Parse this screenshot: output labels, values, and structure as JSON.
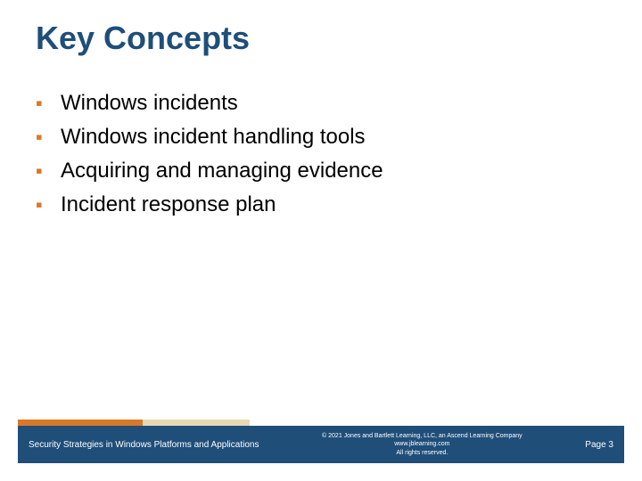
{
  "title": "Key Concepts",
  "bullets": [
    "Windows incidents",
    "Windows incident handling tools",
    "Acquiring and managing evidence",
    "Incident response plan"
  ],
  "footer": {
    "left": "Security Strategies in Windows Platforms and Applications",
    "copyright": "© 2021 Jones and Bartlett Learning, LLC, an Ascend Learning Company",
    "site": "www.jblearning.com",
    "rights": "All rights reserved.",
    "page": "Page 3"
  },
  "colors": {
    "heading": "#1f4e79",
    "accent": "#d97828",
    "footer_bg": "#1f4e79"
  }
}
